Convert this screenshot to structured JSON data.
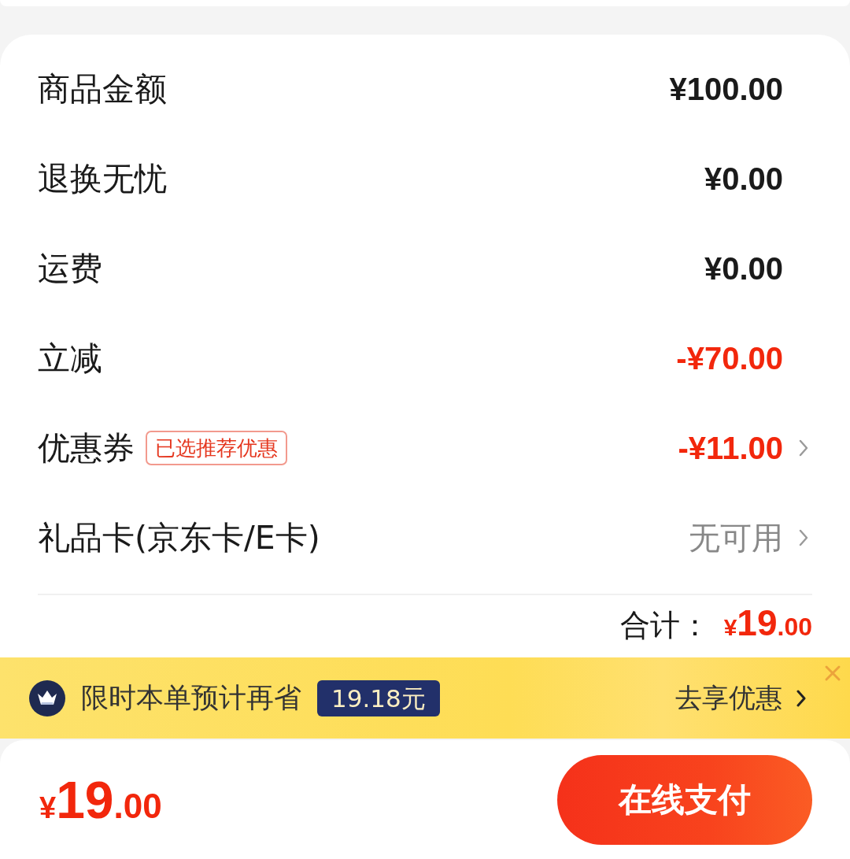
{
  "rows": [
    {
      "label": "商品金额",
      "value": "¥100.00",
      "kind": "amount",
      "has_arrow": false
    },
    {
      "label": "退换无忧",
      "value": "¥0.00",
      "kind": "amount",
      "has_arrow": false
    },
    {
      "label": "运费",
      "value": "¥0.00",
      "kind": "amount",
      "has_arrow": false
    },
    {
      "label": "立减",
      "value": "-¥70.00",
      "kind": "discount",
      "has_arrow": false
    },
    {
      "label": "优惠券",
      "tag": "已选推荐优惠",
      "value": "-¥11.00",
      "kind": "discount",
      "has_arrow": true
    },
    {
      "label": "礼品卡(京东卡/E卡)",
      "value": "无可用",
      "kind": "unavailable",
      "has_arrow": true
    }
  ],
  "total": {
    "label": "合计：",
    "currency": "¥",
    "integer": "19",
    "decimal": ".00"
  },
  "promo_banner": {
    "text": "限时本单预计再省",
    "amount": "19.18元",
    "link": "去享优惠"
  },
  "footer": {
    "currency": "¥",
    "integer": "19",
    "decimal": ".00",
    "pay_button": "在线支付"
  }
}
